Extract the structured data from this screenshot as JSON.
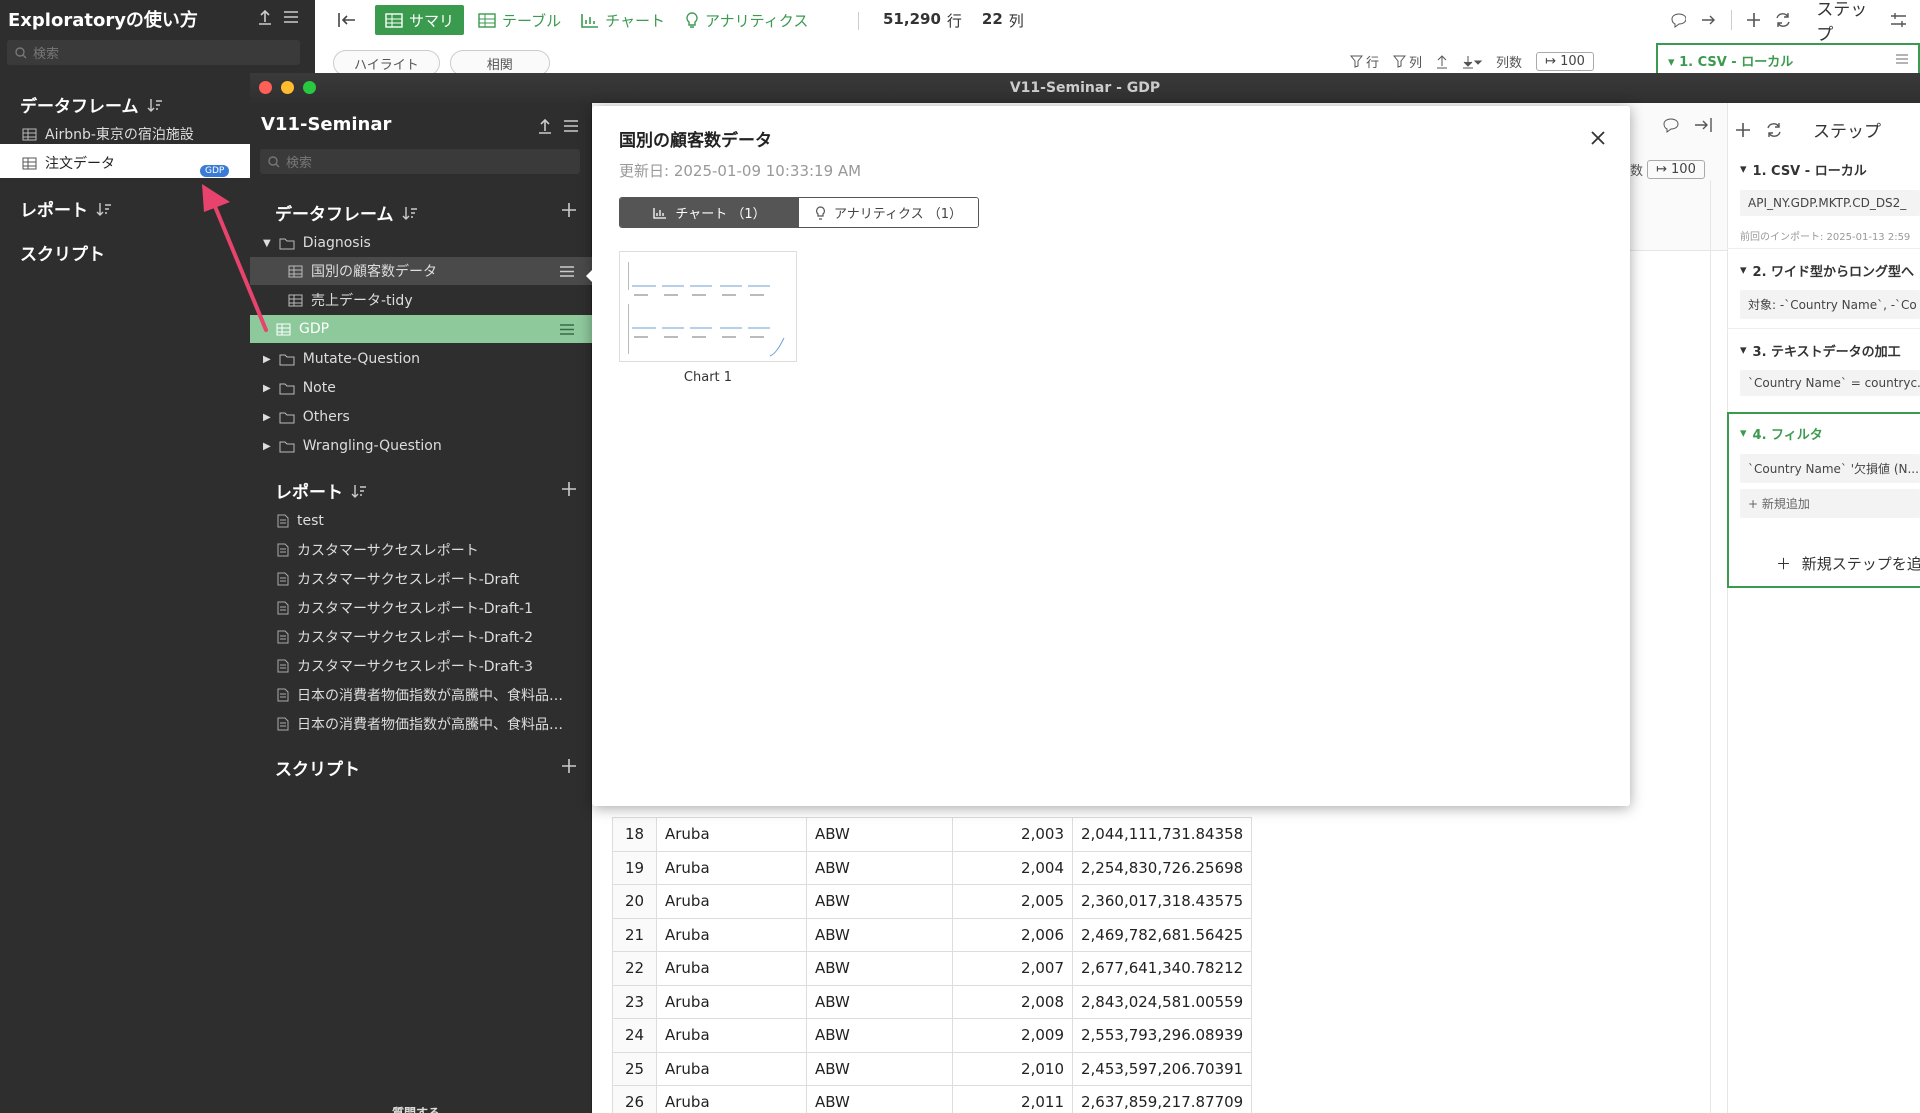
{
  "bg_sidebar": {
    "title": "Exploratoryの使い方",
    "search_placeholder": "検索",
    "dataframes_label": "データフレーム",
    "items": [
      "Airbnb-東京の宿泊施設",
      "注文データ"
    ],
    "badge": "GDP",
    "reports_label": "レポート",
    "scripts_label": "スクリプト"
  },
  "bg_toolbar": {
    "summary": "サマリ",
    "table": "テーブル",
    "chart": "チャート",
    "analytics": "アナリティクス",
    "rows_value": "51,290",
    "rows_unit": "行",
    "cols_value": "22",
    "cols_unit": "列",
    "highlight": "ハイライト",
    "correlation": "相関",
    "filter_rows": "行",
    "filter_cols": "列",
    "col_count_label": "列数",
    "col_count_value": "100",
    "steps_label": "ステップ",
    "step1": "1. CSV - ローカル"
  },
  "window": {
    "title": "V11-Seminar - GDP"
  },
  "win_sidebar": {
    "title": "V11-Seminar",
    "search_placeholder": "検索",
    "dataframes_label": "データフレーム",
    "folder_open": "Diagnosis",
    "diag_items": [
      "国別の顧客数データ",
      "売上データ-tidy"
    ],
    "gdp": "GDP",
    "folders": [
      "Mutate-Question",
      "Note",
      "Others",
      "Wrangling-Question"
    ],
    "reports_label": "レポート",
    "reports": [
      "test",
      "カスタマーサクセスレポート",
      "カスタマーサクセスレポート-Draft",
      "カスタマーサクセスレポート-Draft-1",
      "カスタマーサクセスレポート-Draft-2",
      "カスタマーサクセスレポート-Draft-3",
      "日本の消費者物価指数が高騰中、食料品…",
      "日本の消費者物価指数が高騰中、食料品…"
    ],
    "scripts_label": "スクリプト",
    "bottom_text": "質問する"
  },
  "right_panel": {
    "steps_label": "ステップ",
    "col_count_value": "100",
    "partial_label": "数",
    "step1": "1. CSV - ローカル",
    "step1_file": "API_NY.GDP.MKTP.CD_DS2_",
    "step1_import": "前回のインポート: 2025-01-13 2:59",
    "step2": "2. ワイド型からロング型へ",
    "step2_detail": "対象: -`Country Name`, -`Co",
    "step3": "3. テキストデータの加工",
    "step3_detail": "`Country Name` = countryc...",
    "step4": "4. フィルタ",
    "step4_detail": "`Country Name` '欠損値 (N...",
    "add_new": "新規追加",
    "add_step": "新規ステップを追"
  },
  "table": {
    "rows": [
      {
        "n": "18",
        "country": "Aruba",
        "code": "ABW",
        "year": "2,003",
        "value": "2,044,111,731.84358"
      },
      {
        "n": "19",
        "country": "Aruba",
        "code": "ABW",
        "year": "2,004",
        "value": "2,254,830,726.25698"
      },
      {
        "n": "20",
        "country": "Aruba",
        "code": "ABW",
        "year": "2,005",
        "value": "2,360,017,318.43575"
      },
      {
        "n": "21",
        "country": "Aruba",
        "code": "ABW",
        "year": "2,006",
        "value": "2,469,782,681.56425"
      },
      {
        "n": "22",
        "country": "Aruba",
        "code": "ABW",
        "year": "2,007",
        "value": "2,677,641,340.78212"
      },
      {
        "n": "23",
        "country": "Aruba",
        "code": "ABW",
        "year": "2,008",
        "value": "2,843,024,581.00559"
      },
      {
        "n": "24",
        "country": "Aruba",
        "code": "ABW",
        "year": "2,009",
        "value": "2,553,793,296.08939"
      },
      {
        "n": "25",
        "country": "Aruba",
        "code": "ABW",
        "year": "2,010",
        "value": "2,453,597,206.70391"
      },
      {
        "n": "26",
        "country": "Aruba",
        "code": "ABW",
        "year": "2,011",
        "value": "2,637,859,217.87709"
      }
    ]
  },
  "modal": {
    "title": "国別の顧客数データ",
    "updated": "更新日: 2025-01-09 10:33:19 AM",
    "tab_chart": "チャート （1）",
    "tab_analytics": "アナリティクス （1）",
    "thumb_label": "Chart 1"
  },
  "colors": {
    "accent_green": "#3a9a4e",
    "badge_blue": "#3a7bd5",
    "arrow_pink": "#e8436d"
  },
  "icons": [
    "search-icon",
    "upload-icon",
    "menu-icon",
    "sort-icon",
    "table-icon",
    "folder-icon",
    "report-icon",
    "plus-icon",
    "chart-icon",
    "lightbulb-icon",
    "close-icon",
    "comment-icon",
    "collapse-icon",
    "refresh-icon",
    "filter-icon"
  ]
}
